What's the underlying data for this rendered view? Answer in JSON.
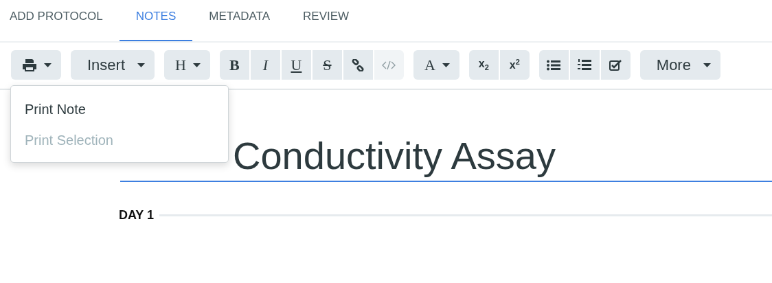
{
  "tabs": [
    {
      "label": "ADD PROTOCOL",
      "selected": false
    },
    {
      "label": "NOTES",
      "selected": true
    },
    {
      "label": "METADATA",
      "selected": false
    },
    {
      "label": "REVIEW",
      "selected": false
    }
  ],
  "toolbar": [
    {
      "buttons": [
        {
          "kind": "print",
          "dropdown": true,
          "disabled": false
        }
      ]
    },
    {
      "buttons": [
        {
          "kind": "text",
          "label": "Insert",
          "dropdown": true,
          "disabled": false
        }
      ]
    },
    {
      "buttons": [
        {
          "kind": "heading",
          "label": "H",
          "dropdown": true,
          "disabled": false
        }
      ]
    },
    {
      "buttons": [
        {
          "kind": "bold",
          "label": "B",
          "dropdown": false,
          "disabled": false
        },
        {
          "kind": "italic",
          "label": "I",
          "dropdown": false,
          "disabled": false
        },
        {
          "kind": "underline",
          "label": "U",
          "dropdown": false,
          "disabled": false
        },
        {
          "kind": "strike",
          "label": "S",
          "dropdown": false,
          "disabled": false
        },
        {
          "kind": "link",
          "dropdown": false,
          "disabled": false
        },
        {
          "kind": "code",
          "dropdown": false,
          "disabled": true
        }
      ]
    },
    {
      "buttons": [
        {
          "kind": "heading",
          "label": "A",
          "dropdown": true,
          "disabled": false
        }
      ]
    },
    {
      "buttons": [
        {
          "kind": "script",
          "label": "x$_{2}$",
          "dropdown": false,
          "disabled": false
        },
        {
          "kind": "script",
          "label": "x$^{2}$",
          "dropdown": false,
          "disabled": false
        }
      ]
    },
    {
      "buttons": [
        {
          "kind": "bullets",
          "dropdown": false,
          "disabled": false
        },
        {
          "kind": "numbers",
          "dropdown": false,
          "disabled": false
        },
        {
          "kind": "checkbox",
          "dropdown": false,
          "disabled": false
        }
      ]
    },
    {
      "buttons": [
        {
          "kind": "text",
          "label": "More",
          "dropdown": true,
          "disabled": false
        }
      ]
    }
  ],
  "menu": {
    "items": [
      {
        "label": "Print Note",
        "disabled": false
      },
      {
        "label": "Print Selection",
        "disabled": true
      }
    ]
  },
  "editor": {
    "title": "Conductivity Assay",
    "section": "DAY 1"
  }
}
